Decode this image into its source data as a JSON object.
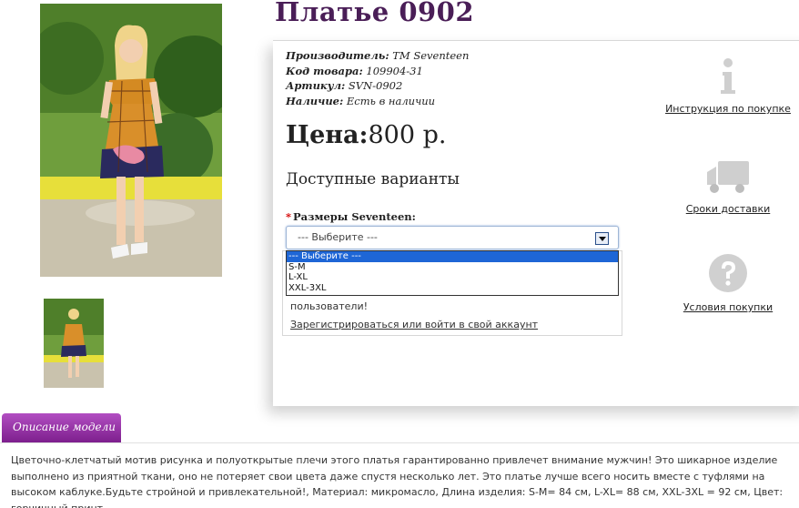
{
  "product": {
    "title": "Платье 0902",
    "attributes": [
      {
        "label": "Производитель:",
        "value": "TM Seventeen"
      },
      {
        "label": "Код товара:",
        "value": "109904-31"
      },
      {
        "label": "Артикул:",
        "value": "SVN-0902"
      },
      {
        "label": "Наличие:",
        "value": "Есть в наличии"
      }
    ],
    "price_label": "Цена:",
    "price_value": "800 р."
  },
  "variants": {
    "title": "Доступные варианты",
    "size_label": "Размеры Seventeen:",
    "required_mark": "*",
    "select_value": "--- Выберите ---",
    "options": [
      "--- Выберите ---",
      "S-M",
      "L-XL",
      "XXL-3XL"
    ],
    "selected_index": 0
  },
  "notice": {
    "text": "пользователи!",
    "login_link": "Зарегистрироваться или войти в свой аккаунт"
  },
  "side_links": {
    "instruction": "Инструкция по покупке",
    "delivery": "Сроки доставки",
    "terms": "Условия покупки"
  },
  "description": {
    "tab_label": "Описание модели",
    "text": "Цветочно-клетчатый мотив рисунка и полуоткрытые плечи этого платья гарантированно привлечет внимание мужчин! Это шикарное изделие выполнено из приятной ткани, оно не потеряет свои цвета даже спустя несколько лет. Это платье лучше всего носить вместе с туфлями на высоком каблуке.Будьте стройной и привлекательной!, Материал: микромасло, Длина изделия: S-M= 84 см, L-XL= 88 см, XXL-3XL = 92 см, Цвет: горчичный принт"
  },
  "icons": {
    "instruction": "info-icon",
    "delivery": "truck-icon",
    "terms": "question-icon",
    "photo": "dress-photo",
    "thumbnail": "dress-thumbnail"
  },
  "colors": {
    "title": "#4a1e57",
    "tab": "#9a35aa",
    "selected_option": "#1e66d6"
  }
}
